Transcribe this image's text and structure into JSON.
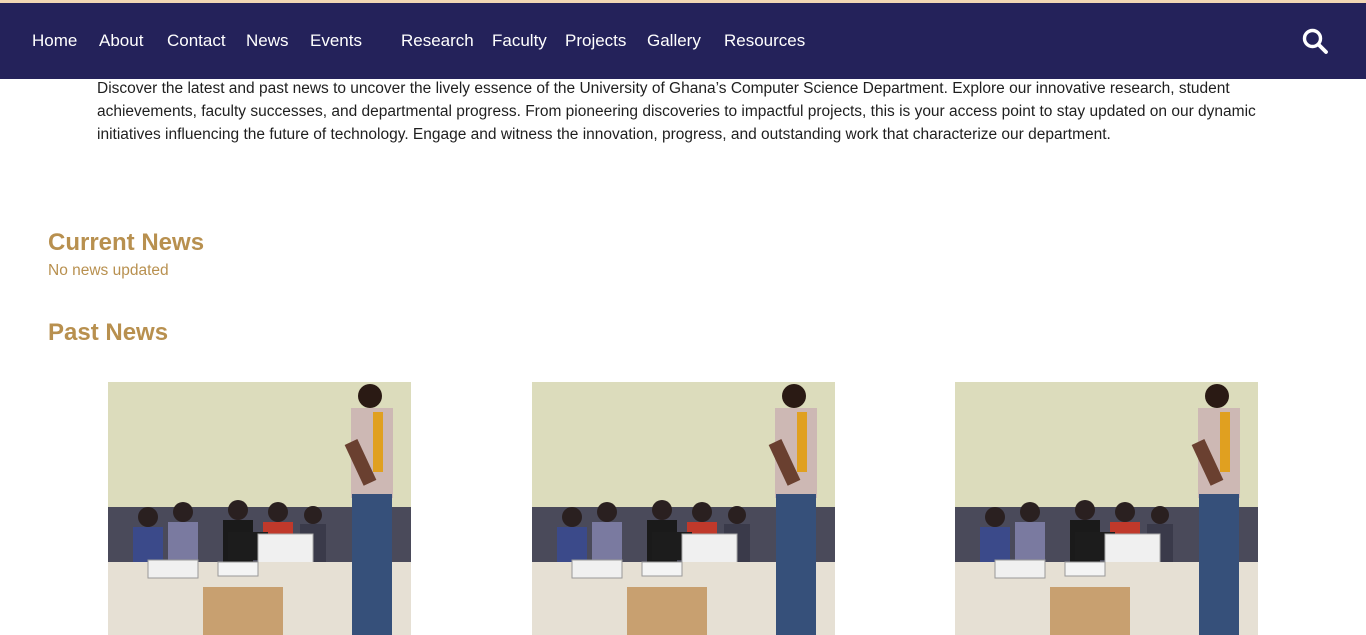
{
  "nav": {
    "items": [
      {
        "label": "Home"
      },
      {
        "label": "About"
      },
      {
        "label": "Contact"
      },
      {
        "label": "News"
      },
      {
        "label": "Events"
      },
      {
        "label": "Research"
      },
      {
        "label": "Faculty"
      },
      {
        "label": "Projects"
      },
      {
        "label": "Gallery"
      },
      {
        "label": "Resources"
      }
    ],
    "search_icon": "search-icon"
  },
  "intro": {
    "text": "Discover the latest and past news to uncover the lively essence of the University of Ghana’s Computer Science Department. Explore our innovative research, student achievements, faculty successes, and departmental progress. From pioneering discoveries to impactful projects, this is your access point to stay updated on our dynamic initiatives influencing the future of technology. Engage and witness the innovation, progress, and outstanding work that characterize our department."
  },
  "current_news": {
    "title": "Current News",
    "empty_text": "No news updated"
  },
  "past_news": {
    "title": "Past News",
    "cards": [
      {
        "image": "classroom-presentation-photo"
      },
      {
        "image": "classroom-presentation-photo"
      },
      {
        "image": "classroom-presentation-photo"
      }
    ]
  },
  "colors": {
    "navbar": "#24225a",
    "accent": "#b8904f",
    "top_strip": "#f1d7b4"
  }
}
